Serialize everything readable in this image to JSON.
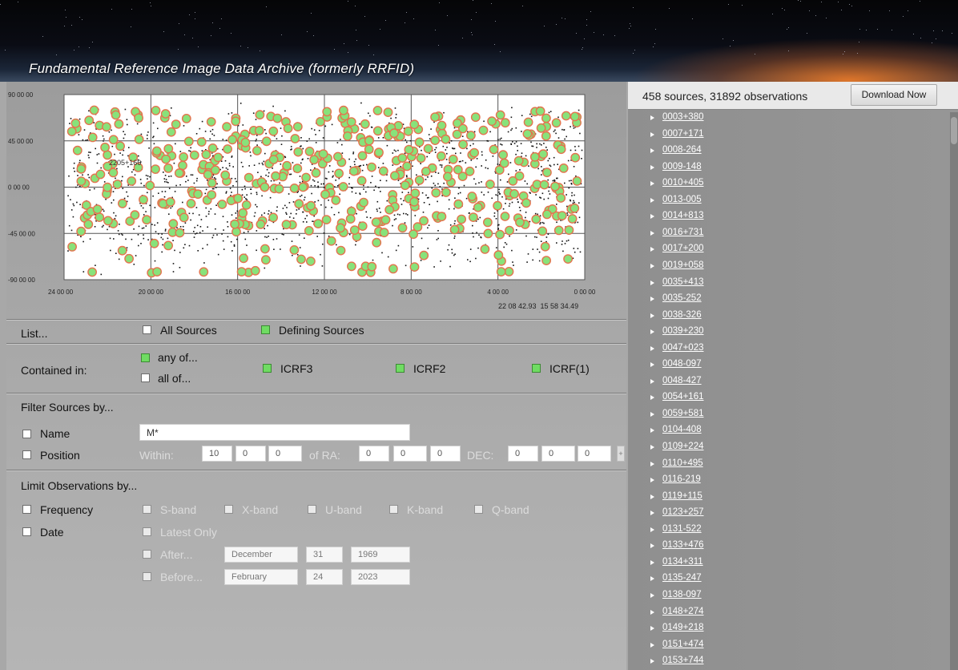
{
  "header": {
    "title": "Fundamental Reference Image Data Archive (formerly RRFID)"
  },
  "plot": {
    "y_ticks": [
      "90 00 00",
      "45 00 00",
      "0 00 00",
      "-45 00 00",
      "-90 00 00"
    ],
    "x_ticks": [
      "24 00 00",
      "20 00 00",
      "16 00 00",
      "12 00 00",
      "8 00 00",
      "4 00 00",
      "0 00 00"
    ],
    "hover_label": "2205+166",
    "cursor_readout": "22 08 42.93  15 58 34.49",
    "colors": {
      "marker_fill": "#88e27a",
      "marker_edge": "#e4744f",
      "dot": "#111111"
    }
  },
  "list": {
    "label": "List...",
    "all_sources": {
      "label": "All Sources",
      "checked": false
    },
    "defining_sources": {
      "label": "Defining Sources",
      "checked": true
    }
  },
  "contained": {
    "label": "Contained in:",
    "any_of": {
      "label": "any of...",
      "checked": true
    },
    "all_of": {
      "label": "all of...",
      "checked": false
    },
    "catalogs": [
      {
        "label": "ICRF3",
        "checked": true
      },
      {
        "label": "ICRF2",
        "checked": true
      },
      {
        "label": "ICRF(1)",
        "checked": true
      }
    ]
  },
  "filter": {
    "heading": "Filter Sources by...",
    "name": {
      "label": "Name",
      "value": "M*"
    },
    "position": {
      "label": "Position",
      "within_label": "Within:",
      "within": [
        "10",
        "0",
        "0"
      ],
      "ra_label": "of RA:",
      "ra": [
        "0",
        "0",
        "0"
      ],
      "dec_label": "DEC:",
      "dec": [
        "0",
        "0",
        "0"
      ],
      "extra_button": "+"
    }
  },
  "limit": {
    "heading": "Limit Observations by...",
    "frequency": {
      "label": "Frequency",
      "bands": [
        "S-band",
        "X-band",
        "U-band",
        "K-band",
        "Q-band"
      ]
    },
    "date": {
      "label": "Date",
      "latest_only": "Latest Only",
      "after": {
        "label": "After...",
        "month": "December",
        "day": "31",
        "year": "1969"
      },
      "before": {
        "label": "Before...",
        "month": "February",
        "day": "24",
        "year": "2023"
      }
    }
  },
  "summary": {
    "text": "458 sources, 31892 observations",
    "download_label": "Download Now"
  },
  "sources": [
    "0003+380",
    "0007+171",
    "0008-264",
    "0009-148",
    "0010+405",
    "0013-005",
    "0014+813",
    "0016+731",
    "0017+200",
    "0019+058",
    "0035+413",
    "0035-252",
    "0038-326",
    "0039+230",
    "0047+023",
    "0048-097",
    "0048-427",
    "0054+161",
    "0059+581",
    "0104-408",
    "0109+224",
    "0110+495",
    "0116-219",
    "0119+115",
    "0123+257",
    "0131-522",
    "0133+476",
    "0134+311",
    "0135-247",
    "0138-097",
    "0148+274",
    "0149+218",
    "0151+474",
    "0153+744"
  ]
}
